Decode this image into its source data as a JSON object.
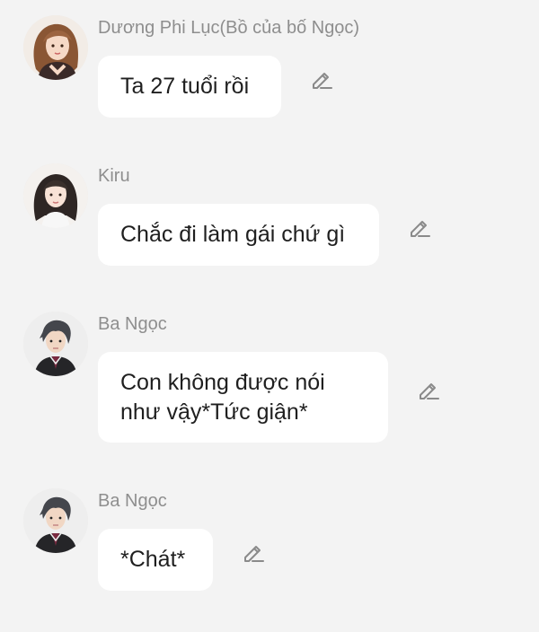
{
  "messages": [
    {
      "sender": "Dương Phi Lục(Bồ của bố Ngọc)",
      "text": "Ta 27 tuổi rồi",
      "avatar_icon": "female-brown-hair-avatar-icon",
      "edit_icon": "pencil-edit-icon"
    },
    {
      "sender": "Kiru",
      "text": "Chắc đi làm gái chứ gì",
      "avatar_icon": "female-dark-hair-avatar-icon",
      "edit_icon": "pencil-edit-icon"
    },
    {
      "sender": "Ba Ngọc",
      "text": "Con không được nói\nnhư vậy*Tức giận*",
      "avatar_icon": "male-suit-avatar-icon",
      "edit_icon": "pencil-edit-icon"
    },
    {
      "sender": "Ba Ngọc",
      "text": "*Chát*",
      "avatar_icon": "male-suit-avatar-icon",
      "edit_icon": "pencil-edit-icon"
    }
  ],
  "colors": {
    "background": "#f3f3f3",
    "bubble": "#ffffff",
    "sender_text": "#8e8e8e",
    "message_text": "#1f1f1f",
    "icon_stroke": "#8a8a8a"
  }
}
